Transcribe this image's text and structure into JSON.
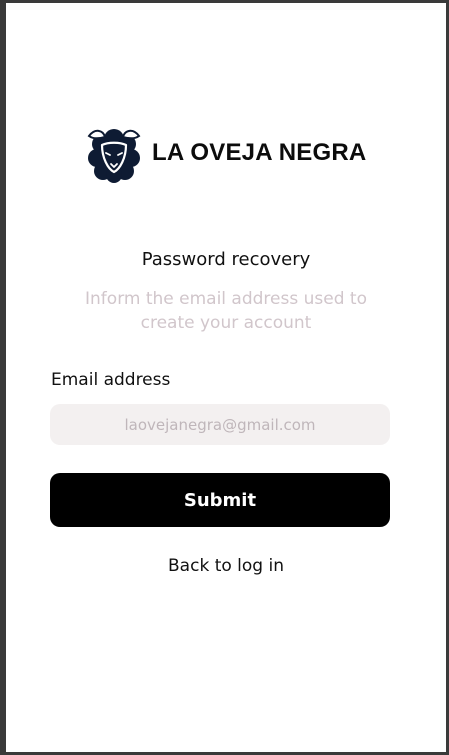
{
  "brand": {
    "name": "LA OVEJA NEGRA",
    "logo_icon": "sheep-icon",
    "logo_color": "#0e1b33"
  },
  "recovery": {
    "title": "Password recovery",
    "subtitle": "Inform  the email address used to create your account"
  },
  "form": {
    "email_label": "Email address",
    "email_value": "",
    "email_placeholder": "laovejanegra@gmail.com",
    "submit_label": "Submit",
    "back_label": "Back to log in"
  },
  "colors": {
    "primary_button": "#000000",
    "input_background": "#f3f0f0",
    "muted_text": "#d1c6cb"
  }
}
